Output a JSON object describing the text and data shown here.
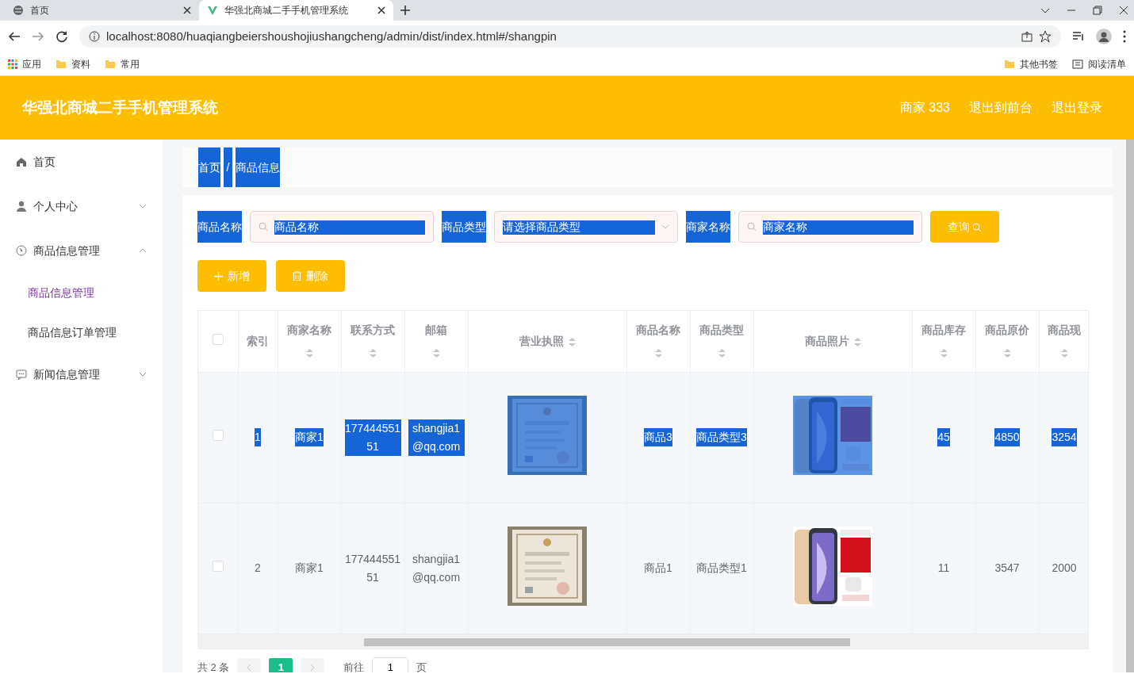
{
  "browser": {
    "tabs": [
      {
        "title": "首页",
        "selected": false
      },
      {
        "title": "华强北商城二手手机管理系统",
        "selected": true
      }
    ],
    "url": "localhost:8080/huaqiangbeiershoushojiushangcheng/admin/dist/index.html#/shangpin",
    "bookmarks": [
      "应用",
      "资料",
      "常用"
    ],
    "bookmarks_right": [
      "其他书签",
      "阅读清单"
    ]
  },
  "header": {
    "title": "华强北商城二手手机管理系统",
    "links": [
      "商家 333",
      "退出到前台",
      "退出登录"
    ]
  },
  "sidebar": {
    "items": [
      {
        "label": "首页",
        "kind": "home"
      },
      {
        "label": "个人中心",
        "kind": "user",
        "expanded": false
      },
      {
        "label": "商品信息管理",
        "kind": "gauge",
        "expanded": true,
        "children": [
          {
            "label": "商品信息管理",
            "selected": true
          },
          {
            "label": "商品信息订单管理",
            "selected": false
          }
        ]
      },
      {
        "label": "新闻信息管理",
        "kind": "chat",
        "expanded": false
      }
    ]
  },
  "breadcrumb": {
    "items": [
      "首页",
      "商品信息"
    ],
    "separator": "/",
    "highlighted": true
  },
  "filters": [
    {
      "label": "商品名称",
      "kind": "text",
      "placeholder": "商品名称",
      "highlighted": true
    },
    {
      "label": "商品类型",
      "kind": "select",
      "placeholder": "请选择商品类型",
      "highlighted": true
    },
    {
      "label": "商家名称",
      "kind": "text",
      "placeholder": "商家名称",
      "highlighted": true
    }
  ],
  "search_button": "查询",
  "actions": [
    {
      "label": "新增",
      "kind": "add"
    },
    {
      "label": "删除",
      "kind": "delete"
    }
  ],
  "table": {
    "header_checked": false,
    "columns": [
      {
        "label": "索引",
        "sortable": false,
        "kind": "narrow"
      },
      {
        "label": "商家名称",
        "sortable": true,
        "kind": "text"
      },
      {
        "label": "联系方式",
        "sortable": true,
        "kind": "text"
      },
      {
        "label": "邮箱",
        "sortable": true,
        "kind": "text"
      },
      {
        "label": "营业执照",
        "sortable": true
      },
      {
        "label": "商品名称",
        "sortable": true,
        "kind": "text"
      },
      {
        "label": "商品类型",
        "sortable": true,
        "kind": "text"
      },
      {
        "label": "商品照片",
        "sortable": true
      },
      {
        "label": "商品库存",
        "sortable": true,
        "kind": "text"
      },
      {
        "label": "商品原价",
        "sortable": true,
        "kind": "text"
      },
      {
        "label": "商品现",
        "sortable": true,
        "kind": "last"
      }
    ],
    "rows": [
      {
        "checked": false,
        "highlighted": true,
        "cells": [
          "1",
          "商家1",
          "17744455151",
          "shangjia1@qq.com",
          {
            "kind": "picture"
          },
          "商品3",
          "商品类型3",
          {
            "kind": "picture"
          },
          "45",
          "4850",
          "3254"
        ]
      },
      {
        "checked": false,
        "highlighted": false,
        "cells": [
          "2",
          "商家1",
          "17744455151",
          "shangjia1@qq.com",
          {
            "kind": "picture"
          },
          "商品1",
          "商品类型1",
          {
            "kind": "picture"
          },
          "11",
          "3547",
          "2000"
        ]
      }
    ]
  },
  "pagination": {
    "total": "共 2 条",
    "pages": [
      {
        "label": "1",
        "selected": true
      }
    ],
    "goto_label": "前往",
    "goto_value": "1",
    "page_suffix": "页"
  }
}
